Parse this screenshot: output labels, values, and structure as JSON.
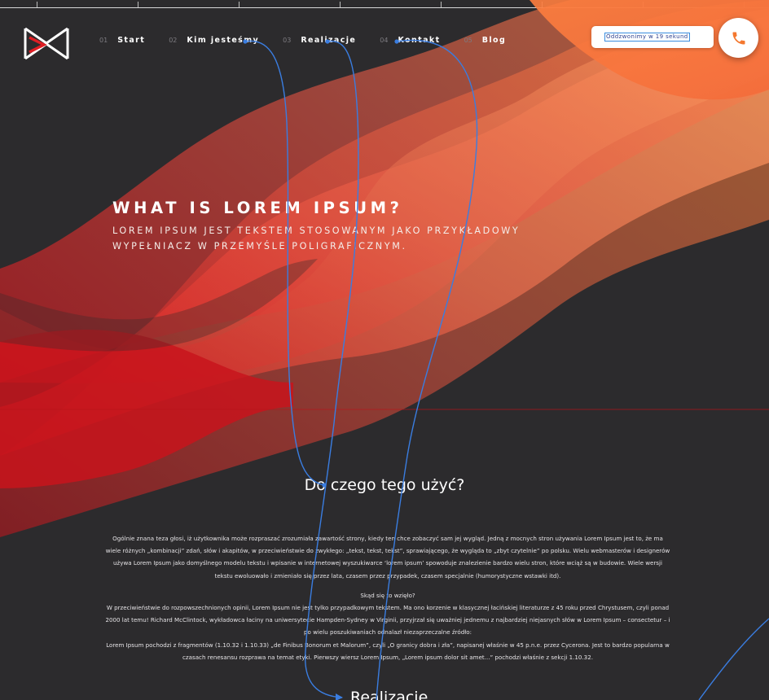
{
  "header": {
    "logo": "brand-logo",
    "nav": [
      {
        "num": "01",
        "label": "Start"
      },
      {
        "num": "02",
        "label": "Kim jesteśmy"
      },
      {
        "num": "03",
        "label": "Realizacje"
      },
      {
        "num": "04",
        "label": "Kontakt"
      },
      {
        "num": "05",
        "label": "Blog"
      }
    ],
    "callback_text": "Oddzwonimy w 19 sekund",
    "call_icon": "phone-icon"
  },
  "hero": {
    "title": "WHAT IS LOREM IPSUM?",
    "subtitle": "LOREM IPSUM JEST TEKSTEM STOSOWANYM JAKO PRZYKŁADOWY WYPEŁNIACZ W PRZEMYŚLE POLIGRAFICZNYM."
  },
  "section": {
    "title": "Do czego tego użyć?",
    "p1": "Ogólnie znana teza głosi, iż użytkownika może rozpraszać zrozumiała zawartość strony, kiedy ten chce zobaczyć sam jej wygląd. Jedną z mocnych stron używania Lorem Ipsum jest to, że ma wiele różnych „kombinacji” zdań, słów i akapitów, w przeciwieństwie do zwykłego: „tekst, tekst, tekst”, sprawiającego, że wygląda to „zbyt czytelnie” po polsku. Wielu webmasterów i designerów używa Lorem Ipsum jako domyślnego modelu tekstu i wpisanie w internetowej wyszukiwarce ‘lorem ipsum’ spowoduje znalezienie bardzo wielu stron, które wciąż są w budowie. Wiele wersji tekstu ewoluowało i zmieniało się przez lata, czasem przez przypadek, czasem specjalnie (humorystyczne wstawki itd).",
    "p2_heading": "Skąd się to wzięło?",
    "p2": "W przeciwieństwie do rozpowszechnionych opinii, Lorem Ipsum nie jest tylko przypadkowym tekstem. Ma ono korzenie w klasycznej łacińskiej literaturze z 45 roku przed Chrystusem, czyli ponad 2000 lat temu! Richard McClintock, wykładowca łaciny na uniwersytecie Hampden-Sydney w Virginii, przyjrzał się uważniej jednemu z najbardziej niejasnych słów w Lorem Ipsum – consectetur – i po wielu poszukiwaniach odnalazł niezaprzeczalne źródło:",
    "p3": "Lorem Ipsum pochodzi z fragmentów (1.10.32 i 1.10.33) „de Finibus Bonorum et Malorum”, czyli „O granicy dobra i zła”, napisanej właśnie w 45 p.n.e. przez Cycerona. Jest to bardzo popularna w czasach renesansu rozprawa na temat etyki. Pierwszy wiersz Lorem Ipsum, „Lorem ipsum dolor sit amet...” pochodzi właśnie z sekcji 1.10.32."
  },
  "section2": {
    "title": "Realizacje"
  },
  "colors": {
    "background": "#2c2b2d",
    "orange": "#ff8a3d",
    "red": "#d3181f",
    "accent_blue": "#3a7de0",
    "phone_orange": "#f4782f"
  }
}
